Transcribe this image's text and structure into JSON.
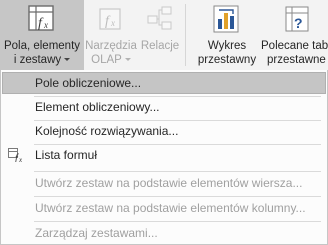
{
  "ribbon": {
    "fields_items_sets": {
      "line1": "Pola, elementy",
      "line2": "i zestawy"
    },
    "olap_tools": {
      "line1": "Narzędzia",
      "line2": "OLAP"
    },
    "relationships": {
      "label": "Relacje"
    },
    "pivotchart": {
      "line1": "Wykres",
      "line2": "przestawny"
    },
    "recommended": {
      "line1": "Polecane tabe",
      "line2": "przestawne"
    }
  },
  "menu": {
    "items": [
      {
        "label": "Pole obliczeniowe...",
        "highlighted": true,
        "enabled": true
      },
      {
        "label": "Element obliczeniowy...",
        "enabled": true
      },
      {
        "label": "Kolejność rozwiązywania...",
        "enabled": true
      },
      {
        "label": "Lista formuł",
        "enabled": true,
        "icon": "formula-list-icon"
      },
      {
        "label": "Utwórz zestaw na podstawie elementów wiersza...",
        "enabled": false
      },
      {
        "label": "Utwórz zestaw na podstawie elementów kolumny...",
        "enabled": false
      },
      {
        "label": "Zarządzaj zestawami...",
        "enabled": false
      }
    ]
  },
  "colors": {
    "highlight": "#c5c5c5",
    "disabled_text": "#a0a0a0",
    "accent_blue": "#2b5797"
  }
}
